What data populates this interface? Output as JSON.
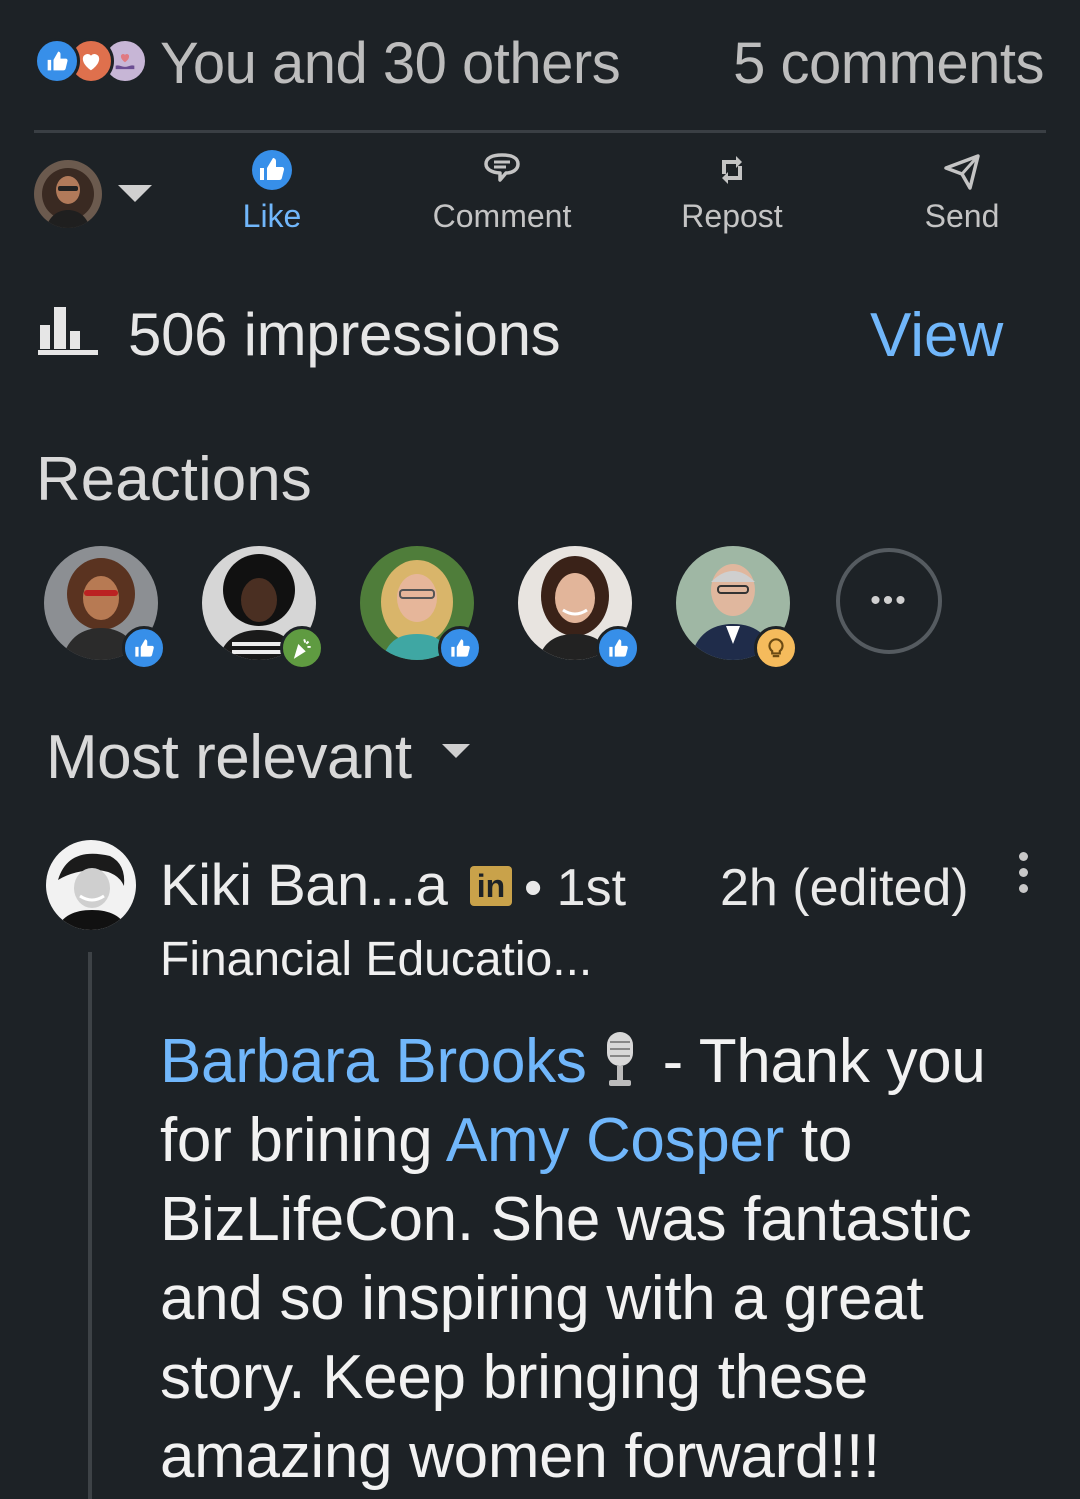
{
  "summary": {
    "reaction_icons": [
      "like-icon",
      "love-icon",
      "support-icon"
    ],
    "reactors_text": "You and 30 others",
    "comments_text": "5 comments"
  },
  "actions": {
    "like": "Like",
    "comment": "Comment",
    "repost": "Repost",
    "send": "Send"
  },
  "impressions": {
    "text": "506 impressions",
    "view_label": "View"
  },
  "reactions": {
    "title": "Reactions",
    "people": [
      {
        "badge": "like-icon"
      },
      {
        "badge": "celebrate-icon"
      },
      {
        "badge": "like-icon"
      },
      {
        "badge": "like-icon"
      },
      {
        "badge": "insightful-icon"
      }
    ],
    "more_label": "•••"
  },
  "sort": {
    "label": "Most relevant"
  },
  "comment": {
    "author": "Kiki Ban...a",
    "badge": "in",
    "degree": "• 1st",
    "time": "2h (edited)",
    "headline": "Financial Educatio...",
    "mention1": "Barbara Brooks",
    "text1": "- Thank you for brining",
    "mention2": "Amy Cosper",
    "text2": "to BizLifeCon.  She was fantastic and so inspiring with a great story.  Keep bringing these amazing women forward!!!"
  },
  "colors": {
    "background": "#1d2226",
    "link": "#71b7fb",
    "like_blue": "#378fe9",
    "celebrate_green": "#5f9b41",
    "insight_gold": "#f5bb5c"
  }
}
